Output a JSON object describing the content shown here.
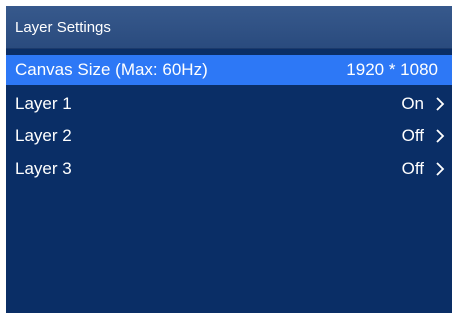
{
  "title": "Layer Settings",
  "menu": {
    "items": [
      {
        "label": "Canvas Size (Max: 60Hz)",
        "value": "1920 * 1080",
        "selected": true,
        "has_arrow": false
      },
      {
        "label": "Layer 1",
        "value": "On",
        "selected": false,
        "has_arrow": true,
        "icon": "chevron-right-icon"
      },
      {
        "label": "Layer 2",
        "value": "Off",
        "selected": false,
        "has_arrow": true,
        "icon": "chevron-right-icon"
      },
      {
        "label": "Layer 3",
        "value": "Off",
        "selected": false,
        "has_arrow": true,
        "icon": "chevron-right-icon"
      }
    ]
  },
  "colors": {
    "background": "#0a2e66",
    "title_bar": "#2f5185",
    "selected_row": "#2d78f6",
    "text": "#ffffff"
  }
}
